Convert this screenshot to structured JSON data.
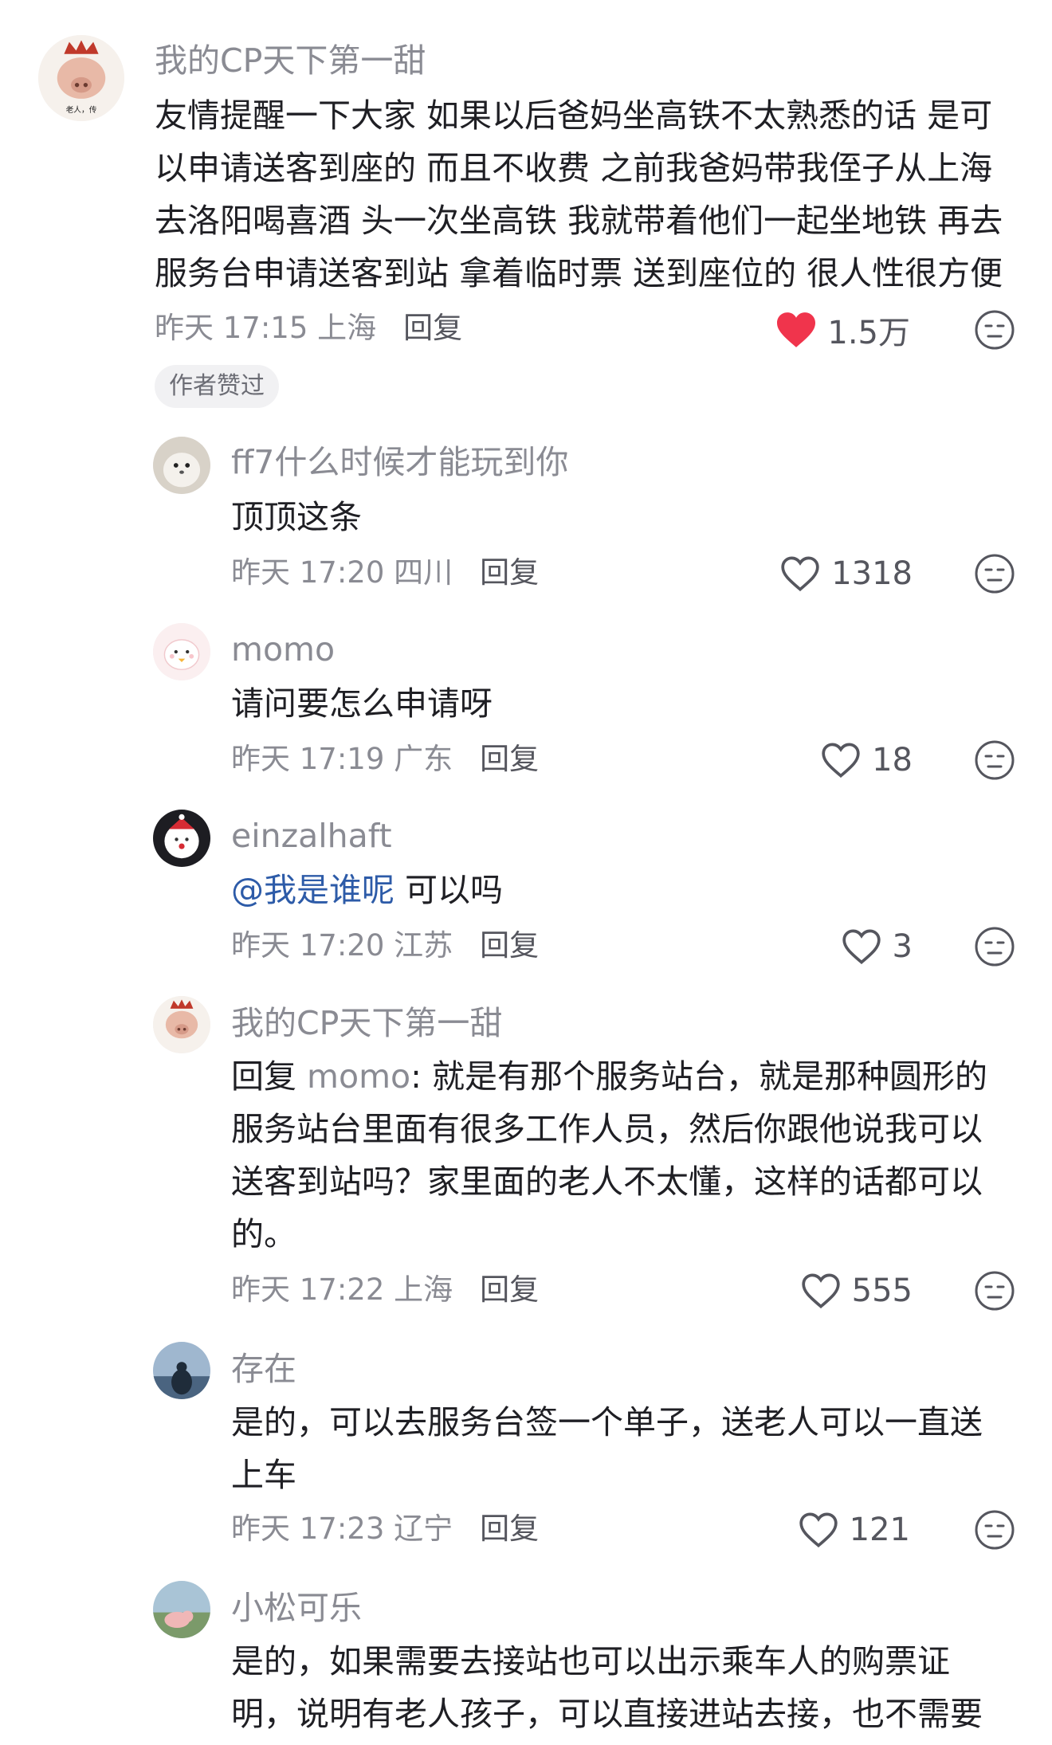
{
  "comments": [
    {
      "username": "我的CP天下第一甜",
      "text": "友情提醒一下大家 如果以后爸妈坐高铁不太熟悉的话 是可以申请送客到座的 而且不收费 之前我爸妈带我侄子从上海去洛阳喝喜酒 头一次坐高铁 我就带着他们一起坐地铁 再去服务台申请送客到站 拿着临时票 送到座位的 很人性很方便",
      "time": "昨天 17:15 上海",
      "reply_label": "回复",
      "likes": "1.5万",
      "liked": true,
      "badge": "作者赞过",
      "avatar_icon": "pig-with-crown-avatar"
    },
    {
      "username": "ff7什么时候才能玩到你",
      "text": "顶顶这条",
      "time": "昨天 17:20 四川",
      "reply_label": "回复",
      "likes": "1318",
      "avatar_icon": "seal-avatar"
    },
    {
      "username": "momo",
      "text": "请问要怎么申请呀",
      "time": "昨天 17:19 广东",
      "reply_label": "回复",
      "likes": "18",
      "avatar_icon": "cartoon-chick-avatar"
    },
    {
      "username": "einzalhaft",
      "mention": "@我是谁呢",
      "text": " 可以吗",
      "time": "昨天 17:20 江苏",
      "reply_label": "回复",
      "likes": "3",
      "avatar_icon": "christmas-bear-avatar"
    },
    {
      "username": "我的CP天下第一甜",
      "reply_prefix": "回复 ",
      "reply_to": "momo",
      "text": ": 就是有那个服务站台，就是那种圆形的服务站台里面有很多工作人员，然后你跟他说我可以送客到站吗？家里面的老人不太懂，这样的话都可以的。",
      "time": "昨天 17:22 上海",
      "reply_label": "回复",
      "likes": "555",
      "avatar_icon": "pig-with-crown-avatar"
    },
    {
      "username": "存在",
      "text": "是的，可以去服务台签一个单子，送老人可以一直送上车",
      "time": "昨天 17:23 辽宁",
      "reply_label": "回复",
      "likes": "121",
      "avatar_icon": "landscape-person-avatar"
    },
    {
      "username": "小松可乐",
      "text": "是的，如果需要去接站也可以出示乘车人的购票证明，说明有老人孩子，可以直接进站去接，也不需要",
      "avatar_icon": "pig-landscape-avatar"
    }
  ],
  "colors": {
    "liked_heart": "#f0344c",
    "mention": "#2d5ba8",
    "meta_gray": "#8a8b93"
  },
  "icons": {
    "like": "heart-icon",
    "dislike": "dislike-face-icon"
  }
}
